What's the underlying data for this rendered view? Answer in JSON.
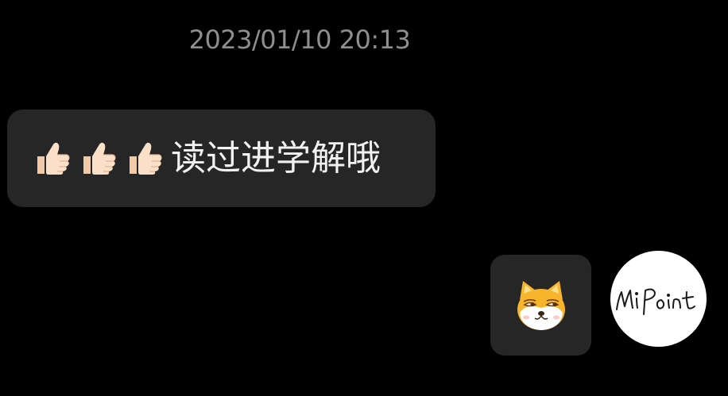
{
  "chat": {
    "timestamp": "2023/01/10 20:13",
    "incoming_message": {
      "reactions": [
        "thumbs-up-icon",
        "thumbs-up-icon",
        "thumbs-up-icon"
      ],
      "text": "读过进学解哦"
    },
    "outgoing_message": {
      "sticker": "shiba-dog-sticker-icon"
    },
    "avatar": {
      "text": "MiPoint"
    }
  },
  "colors": {
    "background": "#000000",
    "bubble": "#262626",
    "timestamp": "#8e8e8e",
    "message_text": "#f2f2f2",
    "avatar_bg": "#ffffff"
  }
}
